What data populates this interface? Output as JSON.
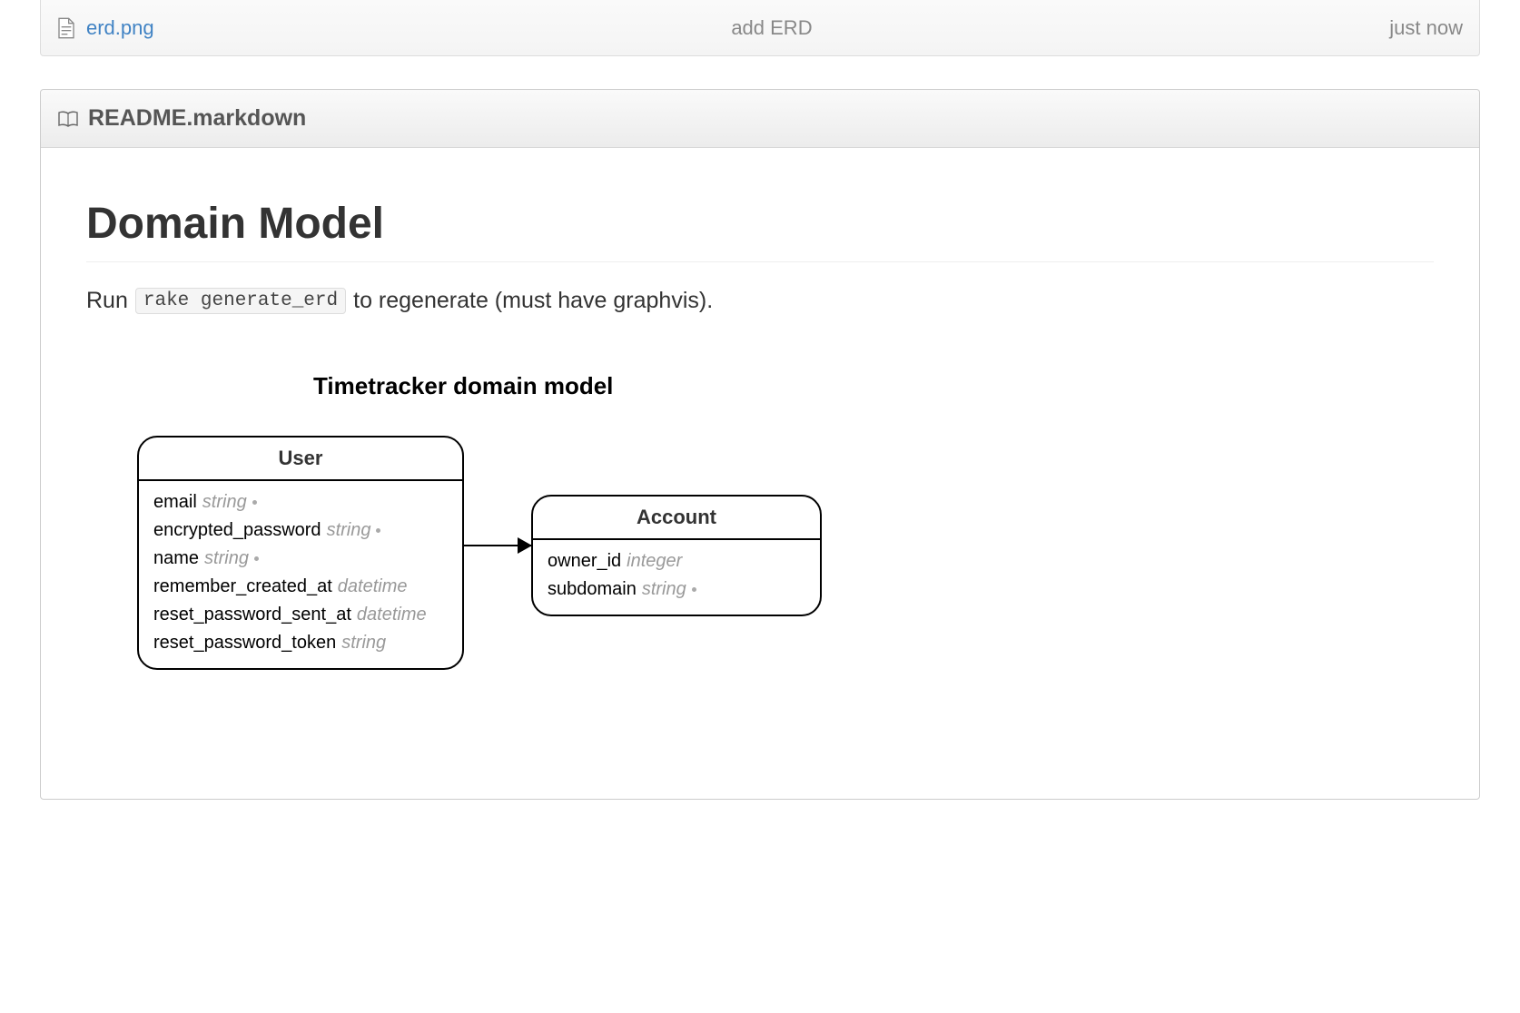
{
  "file_row": {
    "filename": "erd.png",
    "commit_message": "add ERD",
    "time_ago": "just now"
  },
  "readme": {
    "filename": "README.markdown",
    "heading": "Domain Model",
    "description_prefix": "Run",
    "code_command": "rake generate_erd",
    "description_suffix": "to regenerate (must have graphvis)."
  },
  "erd": {
    "title": "Timetracker domain model",
    "entities": {
      "user": {
        "name": "User",
        "fields": [
          {
            "name": "email",
            "type": "string",
            "dot": true
          },
          {
            "name": "encrypted_password",
            "type": "string",
            "dot": true
          },
          {
            "name": "name",
            "type": "string",
            "dot": true
          },
          {
            "name": "remember_created_at",
            "type": "datetime",
            "dot": false
          },
          {
            "name": "reset_password_sent_at",
            "type": "datetime",
            "dot": false
          },
          {
            "name": "reset_password_token",
            "type": "string",
            "dot": false
          }
        ]
      },
      "account": {
        "name": "Account",
        "fields": [
          {
            "name": "owner_id",
            "type": "integer",
            "dot": false
          },
          {
            "name": "subdomain",
            "type": "string",
            "dot": true
          }
        ]
      }
    }
  }
}
